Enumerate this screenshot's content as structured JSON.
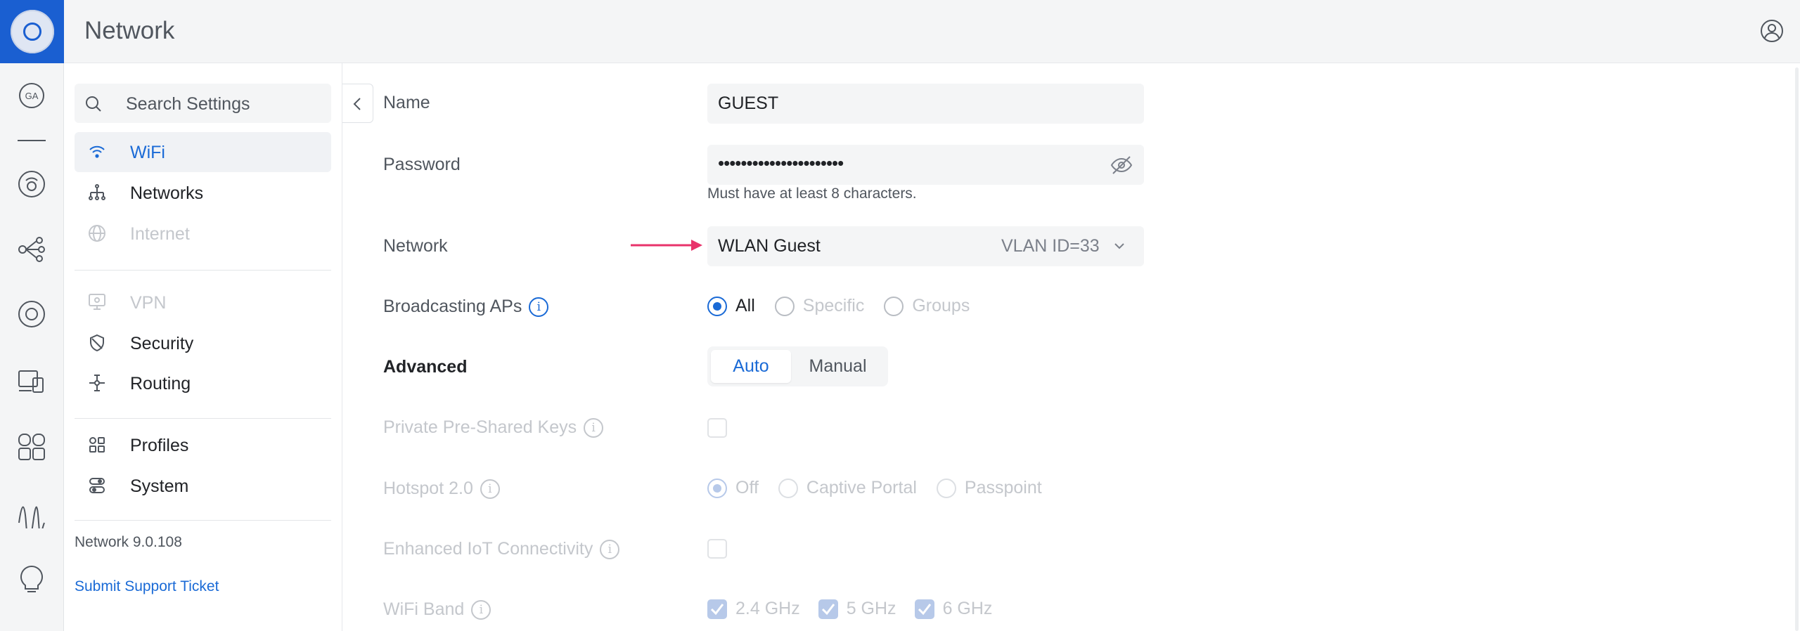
{
  "app": {
    "title": "Network"
  },
  "rail": {
    "icons": [
      "ga-badge-icon",
      "dash-icon",
      "dashboard-icon",
      "topology-icon",
      "devices-icon",
      "clients-icon",
      "apps-icon",
      "insights-icon",
      "alerts-icon"
    ],
    "badge_text": "GA"
  },
  "search": {
    "placeholder": "Search Settings"
  },
  "sidebar": {
    "items": [
      {
        "label": "WiFi",
        "icon": "wifi-icon",
        "state": "active"
      },
      {
        "label": "Networks",
        "icon": "networks-icon",
        "state": "normal"
      },
      {
        "label": "Internet",
        "icon": "globe-icon",
        "state": "disabled"
      },
      {
        "label": "VPN",
        "icon": "vpn-icon",
        "state": "disabled"
      },
      {
        "label": "Security",
        "icon": "shield-icon",
        "state": "normal"
      },
      {
        "label": "Routing",
        "icon": "routing-icon",
        "state": "normal"
      },
      {
        "label": "Profiles",
        "icon": "profiles-icon",
        "state": "normal"
      },
      {
        "label": "System",
        "icon": "system-icon",
        "state": "normal"
      }
    ],
    "version": "Network 9.0.108",
    "support_link": "Submit Support Ticket"
  },
  "form": {
    "name": {
      "label": "Name",
      "value": "GUEST"
    },
    "password": {
      "label": "Password",
      "value": "••••••••••••••••••••••",
      "help": "Must have at least 8 characters."
    },
    "network": {
      "label": "Network",
      "value": "WLAN Guest",
      "vlan": "VLAN ID=33"
    },
    "broadcasting": {
      "label": "Broadcasting APs",
      "options": [
        "All",
        "Specific",
        "Groups"
      ],
      "selected": "All"
    },
    "advanced": {
      "label": "Advanced",
      "options": [
        "Auto",
        "Manual"
      ],
      "selected": "Auto"
    },
    "ppsk": {
      "label": "Private Pre-Shared Keys"
    },
    "hotspot": {
      "label": "Hotspot 2.0",
      "options": [
        "Off",
        "Captive Portal",
        "Passpoint"
      ],
      "selected": "Off"
    },
    "iot": {
      "label": "Enhanced IoT Connectivity"
    },
    "wifi_band": {
      "label": "WiFi Band",
      "options": [
        "2.4 GHz",
        "5 GHz",
        "6 GHz"
      ]
    }
  },
  "colors": {
    "accent": "#1a6ad6",
    "brand": "#1a5fd1",
    "arrow": "#e8336b"
  }
}
